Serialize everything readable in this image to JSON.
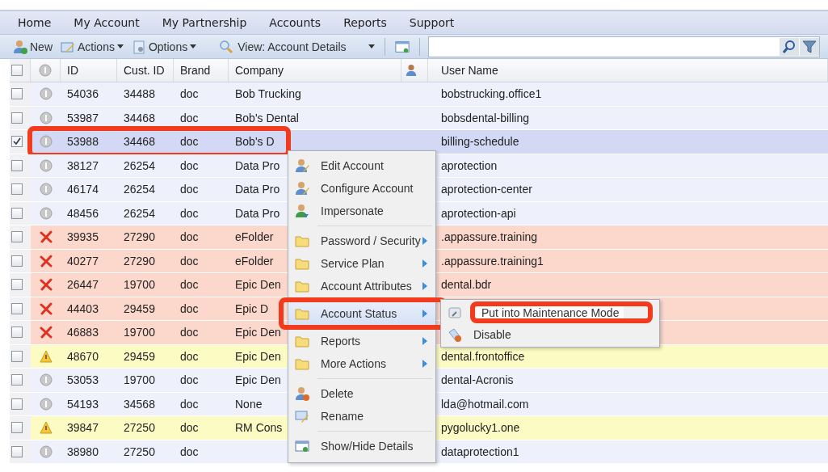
{
  "nav": [
    "Home",
    "My Account",
    "My Partnership",
    "Accounts",
    "Reports",
    "Support"
  ],
  "toolbar": {
    "new": "New",
    "actions": "Actions",
    "options": "Options",
    "view": "View: Account Details"
  },
  "select_all": {
    "checked": false
  },
  "columns": [
    "ID",
    "Cust. ID",
    "Brand",
    "Company",
    "User Name"
  ],
  "rows": [
    {
      "checked": false,
      "kind": "info",
      "id": "54036",
      "cust_id": "34488",
      "brand": "doc",
      "company": "Bob Trucking",
      "user": "bobstrucking.office1",
      "annotated": false
    },
    {
      "checked": false,
      "kind": "info",
      "id": "53987",
      "cust_id": "34468",
      "brand": "doc",
      "company": "Bob's Dental",
      "user": "bobsdental-billing",
      "annotated": false
    },
    {
      "checked": true,
      "kind": "info",
      "id": "53988",
      "cust_id": "34468",
      "brand": "doc",
      "company": "Bob's D",
      "user": "billing-schedule",
      "annotated": true
    },
    {
      "checked": false,
      "kind": "info",
      "id": "38127",
      "cust_id": "26254",
      "brand": "doc",
      "company": "Data Pro",
      "user": "aprotection",
      "annotated": false
    },
    {
      "checked": false,
      "kind": "info",
      "id": "46174",
      "cust_id": "26254",
      "brand": "doc",
      "company": "Data Pro",
      "user": "aprotection-center",
      "annotated": false
    },
    {
      "checked": false,
      "kind": "info",
      "id": "48456",
      "cust_id": "26254",
      "brand": "doc",
      "company": "Data Pro",
      "user": "aprotection-api",
      "annotated": false
    },
    {
      "checked": false,
      "kind": "error",
      "id": "39935",
      "cust_id": "27290",
      "brand": "doc",
      "company": "eFolder",
      "user": ".appassure.training",
      "annotated": false
    },
    {
      "checked": false,
      "kind": "error",
      "id": "40277",
      "cust_id": "27290",
      "brand": "doc",
      "company": "eFolder",
      "user": ".appassure.training1",
      "annotated": false
    },
    {
      "checked": false,
      "kind": "error",
      "id": "26447",
      "cust_id": "19700",
      "brand": "doc",
      "company": "Epic Den",
      "user": "dental.bdr",
      "annotated": false
    },
    {
      "checked": false,
      "kind": "error",
      "id": "44403",
      "cust_id": "29459",
      "brand": "doc",
      "company": "Epic D",
      "annotated": false
    },
    {
      "checked": false,
      "kind": "error",
      "id": "46883",
      "cust_id": "19700",
      "brand": "doc",
      "company": "Epic Den",
      "annotated": false
    },
    {
      "checked": false,
      "kind": "warning",
      "id": "48670",
      "cust_id": "29459",
      "brand": "doc",
      "company": "Epic Den",
      "user": "dental.frontoffice",
      "annotated": false
    },
    {
      "checked": false,
      "kind": "info",
      "id": "53053",
      "cust_id": "19700",
      "brand": "doc",
      "company": "Epic Den",
      "user": "dental-Acronis",
      "annotated": false
    },
    {
      "checked": false,
      "kind": "info",
      "id": "54193",
      "cust_id": "34568",
      "brand": "doc",
      "company": "None",
      "user": "lda@hotmail.com",
      "annotated": false
    },
    {
      "checked": false,
      "kind": "warning",
      "id": "39847",
      "cust_id": "27250",
      "brand": "doc",
      "company": "RM Cons",
      "user": "pygolucky1.one",
      "annotated": false
    },
    {
      "checked": false,
      "kind": "info",
      "id": "38980",
      "cust_id": "27250",
      "brand": "doc",
      "user": "dataprotection1",
      "annotated": false
    }
  ],
  "context_menu": [
    [
      {
        "label": "Edit Account",
        "kind": "user-edit",
        "submenu": false,
        "selected": false,
        "annotated": false
      },
      {
        "label": "Configure Account",
        "kind": "user-edit",
        "submenu": false,
        "selected": false,
        "annotated": false
      },
      {
        "label": "Impersonate",
        "kind": "user-swap",
        "submenu": false,
        "selected": false,
        "annotated": false
      }
    ],
    [
      {
        "label": "Password / Security",
        "kind": "folder",
        "submenu": true,
        "selected": false,
        "annotated": false
      },
      {
        "label": "Service Plan",
        "kind": "folder",
        "submenu": true,
        "selected": false,
        "annotated": false
      },
      {
        "label": "Account Attributes",
        "kind": "folder",
        "submenu": true,
        "selected": false,
        "annotated": false
      },
      {
        "label": "Account Status",
        "kind": "folder",
        "submenu": true,
        "selected": true,
        "annotated": true
      },
      {
        "label": "Reports",
        "kind": "folder",
        "submenu": true,
        "selected": false,
        "annotated": false
      },
      {
        "label": "More Actions",
        "kind": "folder",
        "submenu": true,
        "selected": false,
        "annotated": false
      }
    ],
    [
      {
        "label": "Delete",
        "kind": "user-delete",
        "submenu": false,
        "selected": false,
        "annotated": false
      },
      {
        "label": "Rename",
        "kind": "rename",
        "submenu": false,
        "selected": false,
        "annotated": false
      }
    ],
    [
      {
        "label": "Show/Hide Details",
        "kind": "window",
        "submenu": false,
        "selected": false,
        "annotated": false
      }
    ]
  ],
  "submenu": [
    {
      "label": "Put into Maintenance Mode",
      "kind": "wrench",
      "selected": true,
      "annotated": true
    },
    {
      "label": "Disable",
      "kind": "tag-delete",
      "selected": false,
      "annotated": false
    }
  ]
}
